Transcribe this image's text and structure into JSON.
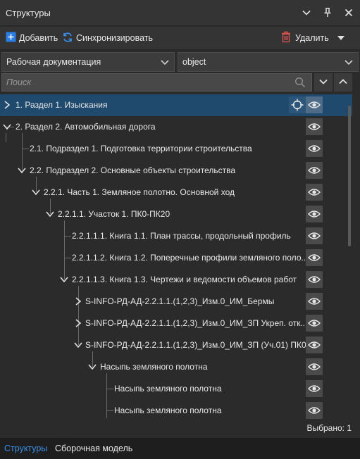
{
  "window": {
    "title": "Структуры"
  },
  "toolbar": {
    "add_label": "Добавить",
    "sync_label": "Синхронизировать",
    "delete_label": "Удалить"
  },
  "filters": {
    "doc_type": "Рабочая документация",
    "object": "object"
  },
  "search": {
    "placeholder": "Поиск"
  },
  "tree": [
    {
      "label": "1. Раздел 1. Изыскания",
      "level": 0,
      "expanded": false,
      "selected": true
    },
    {
      "label": "2. Раздел 2. Автомобильная дорога",
      "level": 0,
      "expanded": true
    },
    {
      "label": "2.1. Подраздел 1. Подготовка территории строительства",
      "level": 1
    },
    {
      "label": "2.2. Подраздел 2. Основные объекты строительства",
      "level": 1,
      "expanded": true
    },
    {
      "label": "2.2.1. Часть 1. Земляное полотно. Основной ход",
      "level": 2,
      "expanded": true
    },
    {
      "label": "2.2.1.1. Участок 1. ПК0-ПК20",
      "level": 3,
      "expanded": true
    },
    {
      "label": "2.2.1.1.1. Книга 1.1. План трассы, продольный профиль",
      "level": 4
    },
    {
      "label": "2.2.1.1.2. Книга 1.2. Поперечные профили земляного поло...",
      "level": 4
    },
    {
      "label": "2.2.1.1.3. Книга 1.3. Чертежи и ведомости объемов работ",
      "level": 4,
      "expanded": true
    },
    {
      "label": "S-INFO-РД-АД-2.2.1.1.(1,2,3)_Изм.0_ИМ_Бермы",
      "level": 5,
      "expanded": false
    },
    {
      "label": "S-INFO-РД-АД-2.2.1.1.(1,2,3)_Изм.0_ИМ_ЗП Укреп. отк...",
      "level": 5,
      "expanded": false
    },
    {
      "label": "S-INFO-РД-АД-2.2.1.1.(1,2,3)_Изм.0_ИМ_ЗП (Уч.01) ПК0...",
      "level": 5,
      "expanded": true
    },
    {
      "label": "Насыпь земляного полотна",
      "level": 6,
      "expanded": true
    },
    {
      "label": "Насыпь земляного полотна",
      "level": 7
    },
    {
      "label": "Насыпь земляного полотна",
      "level": 7
    }
  ],
  "status": {
    "selected_text": "Выбрано: 1"
  },
  "bottom_tabs": [
    {
      "label": "Структуры",
      "active": true
    },
    {
      "label": "Сборочная модель",
      "active": false
    }
  ],
  "colors": {
    "accent": "#2a7de1",
    "selected_row": "#1f4a6e",
    "delete_red": "#d9534f"
  }
}
